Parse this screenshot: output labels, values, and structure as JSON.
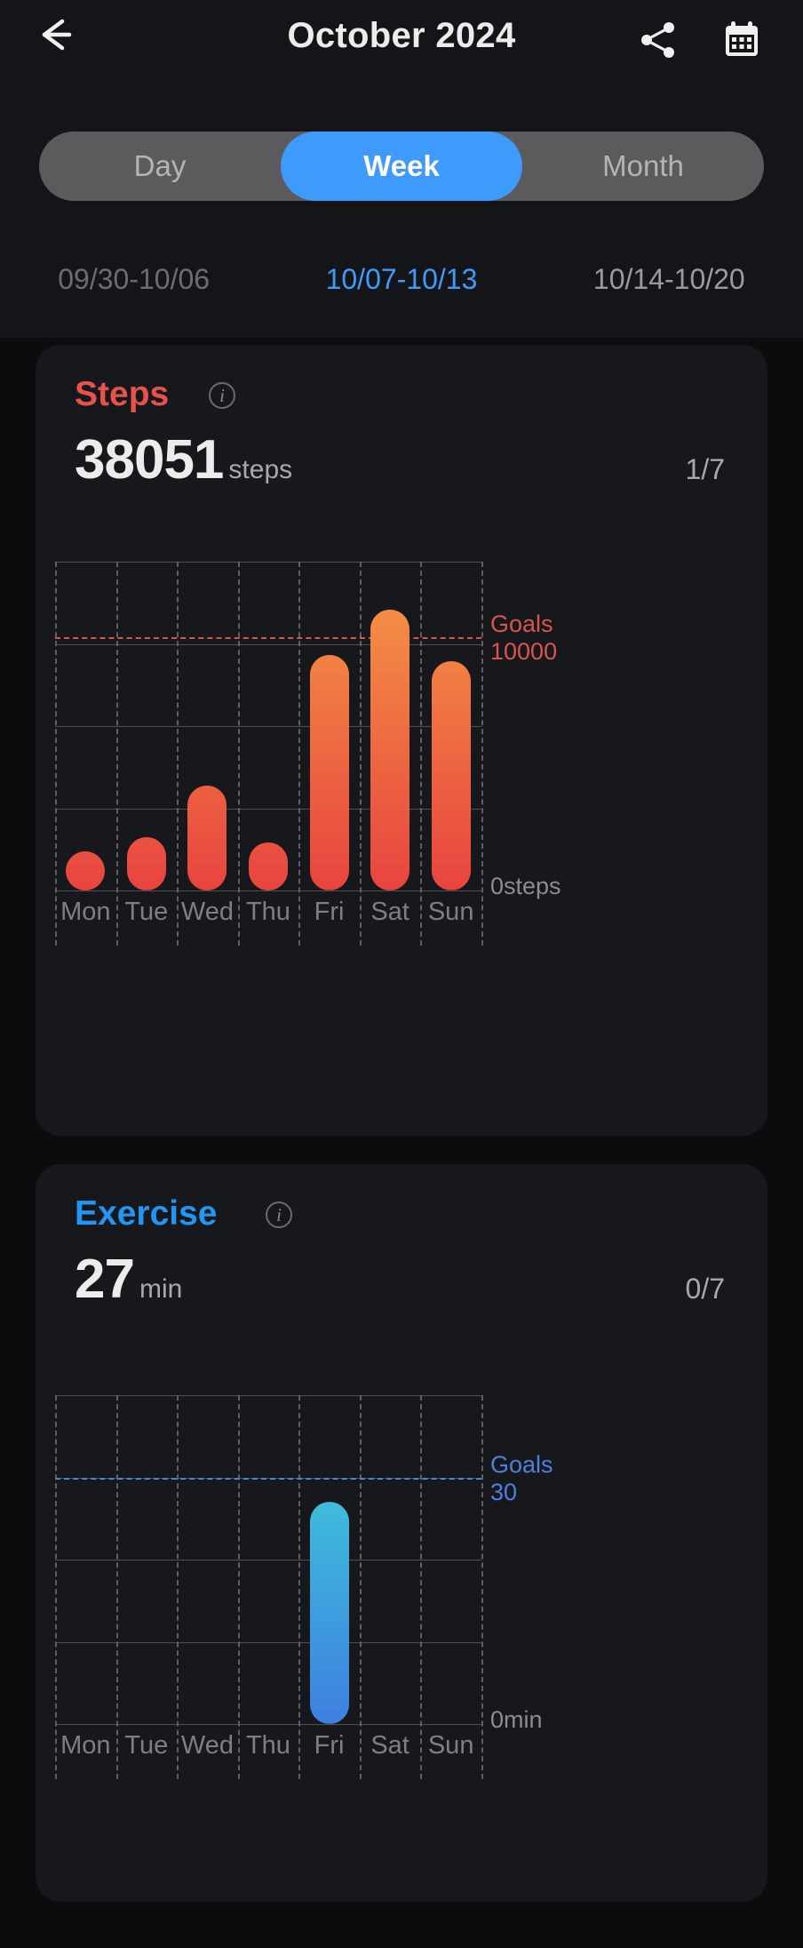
{
  "header": {
    "title": "October 2024",
    "back_icon": "arrow-left-icon",
    "share_icon": "share-icon",
    "calendar_icon": "calendar-icon"
  },
  "period_tabs": [
    {
      "label": "Day",
      "active": false
    },
    {
      "label": "Week",
      "active": true
    },
    {
      "label": "Month",
      "active": false
    }
  ],
  "week_selector": [
    {
      "label": "09/30-10/06",
      "state": "prev"
    },
    {
      "label": "10/07-10/13",
      "state": "current"
    },
    {
      "label": "10/14-10/20",
      "state": "next"
    }
  ],
  "cards": [
    {
      "name": "Steps",
      "accent": "#e8524d",
      "value": "38051",
      "unit": "steps",
      "fraction": "1/7",
      "goal_label": "Goals",
      "goal_value": "10000",
      "zero_label": "0steps",
      "info_icon": "info-icon"
    },
    {
      "name": "Exercise",
      "accent": "#2196f3",
      "value": "27",
      "unit": "min",
      "fraction": "0/7",
      "goal_label": "Goals",
      "goal_value": "30",
      "zero_label": "0min",
      "info_icon": "info-icon"
    }
  ],
  "chart_data": [
    {
      "type": "bar",
      "title": "Steps",
      "categories": [
        "Mon",
        "Tue",
        "Wed",
        "Thu",
        "Fri",
        "Sat",
        "Sun"
      ],
      "values": [
        380,
        2100,
        4150,
        1900,
        9300,
        11100,
        9050
      ],
      "total": 38051,
      "goal": 10000,
      "goal_label": "Goals 10000",
      "ylabel": "steps",
      "ylim": [
        0,
        13000
      ],
      "yticks": [
        0,
        3250,
        6500,
        9750,
        13000
      ],
      "grid": true,
      "bar_color_top": "#f59a45",
      "bar_color_bottom": "#e8443f",
      "goal_color": "#d9534f",
      "days_met_goal": "1/7"
    },
    {
      "type": "bar",
      "title": "Exercise",
      "categories": [
        "Mon",
        "Tue",
        "Wed",
        "Thu",
        "Fri",
        "Sat",
        "Sun"
      ],
      "values": [
        0,
        0,
        0,
        0,
        27,
        0,
        0
      ],
      "total": 27,
      "goal": 30,
      "goal_label": "Goals 30",
      "ylabel": "min",
      "ylim": [
        0,
        40
      ],
      "yticks": [
        0,
        10,
        20,
        30,
        40
      ],
      "grid": true,
      "bar_color_top": "#3fd9d9",
      "bar_color_bottom": "#3e7fe0",
      "goal_color": "#4f7fe0",
      "days_met_goal": "0/7"
    }
  ]
}
